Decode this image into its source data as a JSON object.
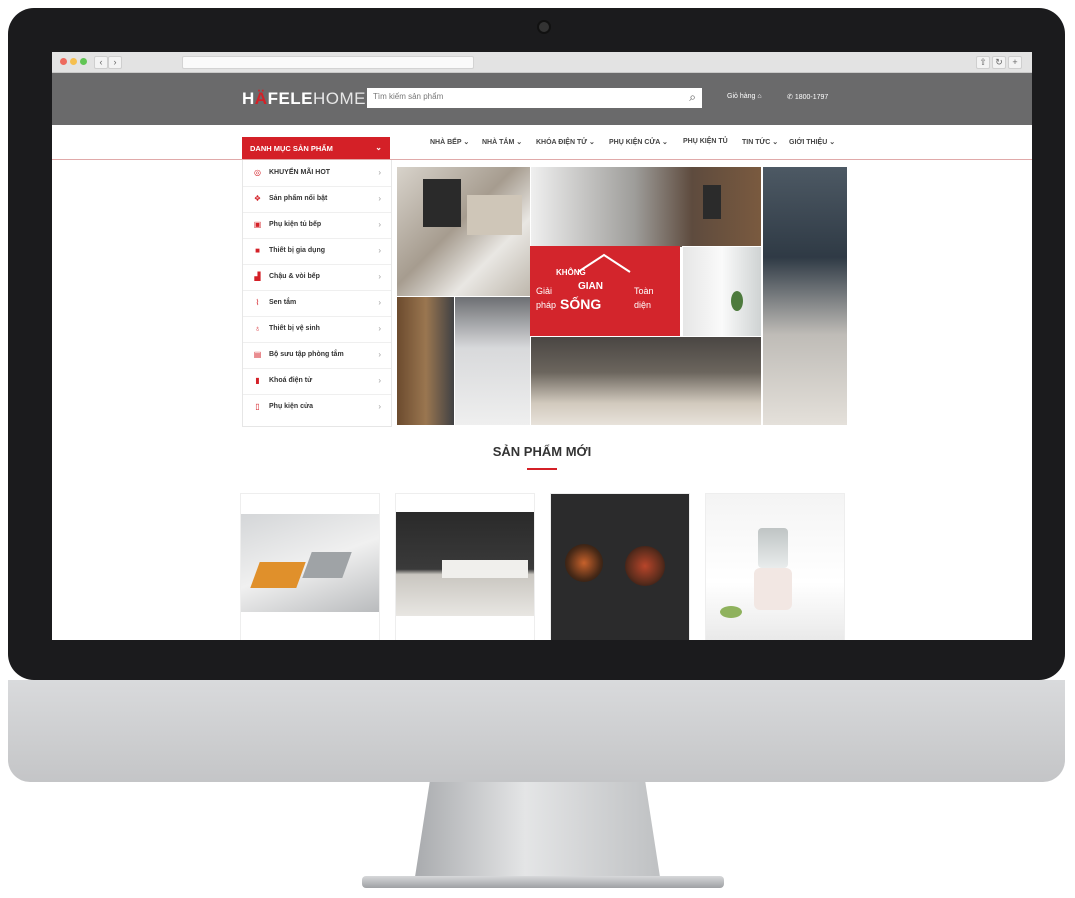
{
  "browser": {
    "nav_back": "‹",
    "nav_forward": "›",
    "traffic_light_colors": [
      "#ed6a5e",
      "#f5bf4f",
      "#61c554"
    ]
  },
  "header": {
    "logo_h": "H",
    "logo_mark": "Ä",
    "logo_fele": "FELE",
    "logo_home": "HOME",
    "search_placeholder": "Tìm kiếm sản phẩm",
    "search_icon": "search-icon",
    "cart_label": "Giỏ hàng",
    "phone": "1800-1797"
  },
  "nav": {
    "category_button": "DANH MỤC SẢN PHẨM",
    "items": [
      "NHÀ BẾP ⌄",
      "NHÀ TẮM ⌄",
      "KHÓA ĐIỆN TỬ ⌄",
      "PHỤ KIỆN CỬA ⌄",
      "PHỤ KIỆN TỦ",
      "TIN TỨC ⌄",
      "GIỚI THIỆU ⌄"
    ]
  },
  "sidebar": {
    "items": [
      {
        "label": "KHUYẾN MÃI HOT",
        "icon": "tag-icon"
      },
      {
        "label": "Sản phẩm nổi bật",
        "icon": "star-icon"
      },
      {
        "label": "Phụ kiện tủ bếp",
        "icon": "cabinet-icon"
      },
      {
        "label": "Thiết bị gia dụng",
        "icon": "appliance-icon"
      },
      {
        "label": "Chậu & vòi bếp",
        "icon": "sink-icon"
      },
      {
        "label": "Sen tắm",
        "icon": "shower-icon"
      },
      {
        "label": "Thiết bị vệ sinh",
        "icon": "toilet-icon"
      },
      {
        "label": "Bộ sưu tập phòng tắm",
        "icon": "bathroom-icon"
      },
      {
        "label": "Khoá điện tử",
        "icon": "lock-icon"
      },
      {
        "label": "Phụ kiện cửa",
        "icon": "door-icon"
      }
    ]
  },
  "banner": {
    "line1": "KHÔNG",
    "line2a": "Giải",
    "line2b": "GIAN",
    "line2c": "Toàn",
    "line3a": "pháp",
    "line3b": "SỐNG",
    "line3c": "diện"
  },
  "section": {
    "title": "SẢN PHẨM MỚI"
  },
  "colors": {
    "brand_red": "#d42027",
    "header_gray": "#6a6a6b"
  }
}
